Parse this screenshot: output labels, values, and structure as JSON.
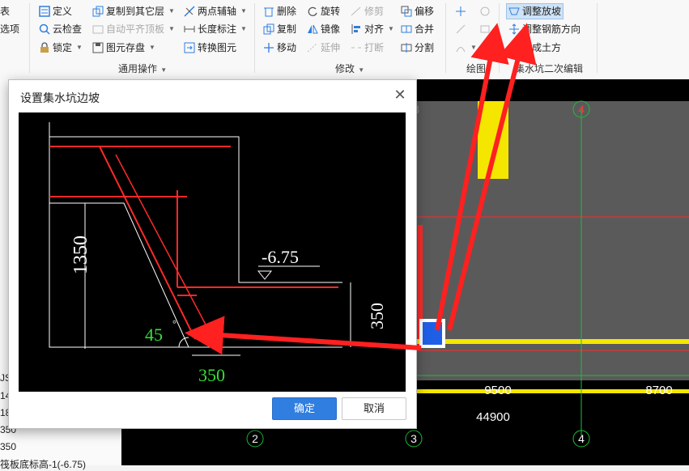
{
  "ribbon": {
    "left_edge": {
      "table": "表",
      "select": "选项"
    },
    "group_common": {
      "label": "通用操作",
      "define": "定义",
      "cloud_check": "云检查",
      "lock": "锁定",
      "copy_to_other_floor": "复制到其它层",
      "auto_flat_top": "自动平齐顶板",
      "element_save": "图元存盘",
      "two_point_axis": "两点辅轴",
      "length_label": "长度标注",
      "convert_element": "转换图元"
    },
    "group_modify": {
      "label": "修改",
      "delete": "删除",
      "copy": "复制",
      "move": "移动",
      "rotate": "旋转",
      "mirror": "镜像",
      "extend": "延伸",
      "trim": "修剪",
      "align": "对齐",
      "break": "打断",
      "offset": "偏移",
      "merge": "合并",
      "split": "分割"
    },
    "group_draw": {
      "label": "绘图"
    },
    "group_pit_edit": {
      "label": "集水坑二次编辑",
      "adjust_slope": "调整放坡",
      "adjust_rebar_dir": "调整钢筋方向",
      "gen_earthwork": "生成土方"
    }
  },
  "dialog": {
    "title": "设置集水坑边坡",
    "ok": "确定",
    "cancel": "取消",
    "drawing": {
      "dim_height": "1350",
      "angle_value": "45",
      "bottom_offset": "350",
      "elevation": "-6.75",
      "right_dim": "350"
    }
  },
  "canvas": {
    "axis_top": "4",
    "axis_left_partial": "3",
    "dims": [
      "9500",
      "8700",
      "44900"
    ],
    "axis_bottom": [
      "2",
      "3",
      "4"
    ]
  },
  "left_panel": {
    "rows": [
      "JS",
      "14",
      "18",
      "350",
      "350",
      "筏板底标高-1(-6.75)"
    ]
  },
  "colors": {
    "accent": "#2f7ee0",
    "cad_bg": "#000000",
    "red": "#ff2a2a",
    "yellow": "#f5e600",
    "green_text": "#36e036"
  }
}
